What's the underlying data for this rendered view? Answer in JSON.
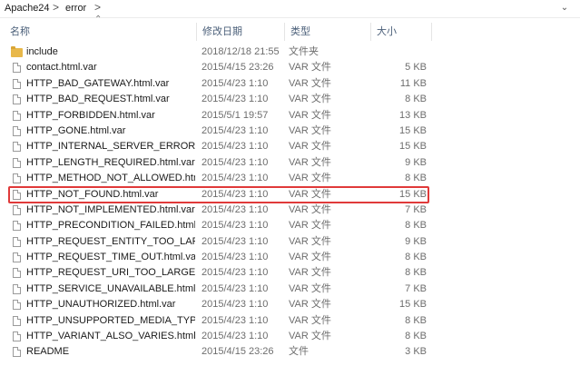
{
  "breadcrumb": {
    "items": [
      "Apache24",
      "error"
    ],
    "separator": ">"
  },
  "columns": {
    "name": "名称",
    "date": "修改日期",
    "type": "类型",
    "size": "大小"
  },
  "highlight_color": "#e03a3a",
  "files": [
    {
      "icon": "folder-icon",
      "name": "include",
      "date": "2018/12/18 21:55",
      "type": "文件夹",
      "size": ""
    },
    {
      "icon": "file-icon",
      "name": "contact.html.var",
      "date": "2015/4/15 23:26",
      "type": "VAR 文件",
      "size": "5 KB"
    },
    {
      "icon": "file-icon",
      "name": "HTTP_BAD_GATEWAY.html.var",
      "date": "2015/4/23 1:10",
      "type": "VAR 文件",
      "size": "11 KB"
    },
    {
      "icon": "file-icon",
      "name": "HTTP_BAD_REQUEST.html.var",
      "date": "2015/4/23 1:10",
      "type": "VAR 文件",
      "size": "8 KB"
    },
    {
      "icon": "file-icon",
      "name": "HTTP_FORBIDDEN.html.var",
      "date": "2015/5/1 19:57",
      "type": "VAR 文件",
      "size": "13 KB"
    },
    {
      "icon": "file-icon",
      "name": "HTTP_GONE.html.var",
      "date": "2015/4/23 1:10",
      "type": "VAR 文件",
      "size": "15 KB"
    },
    {
      "icon": "file-icon",
      "name": "HTTP_INTERNAL_SERVER_ERROR.ht...",
      "date": "2015/4/23 1:10",
      "type": "VAR 文件",
      "size": "15 KB"
    },
    {
      "icon": "file-icon",
      "name": "HTTP_LENGTH_REQUIRED.html.var",
      "date": "2015/4/23 1:10",
      "type": "VAR 文件",
      "size": "9 KB"
    },
    {
      "icon": "file-icon",
      "name": "HTTP_METHOD_NOT_ALLOWED.html...",
      "date": "2015/4/23 1:10",
      "type": "VAR 文件",
      "size": "8 KB"
    },
    {
      "icon": "file-icon",
      "name": "HTTP_NOT_FOUND.html.var",
      "date": "2015/4/23 1:10",
      "type": "VAR 文件",
      "size": "15 KB",
      "highlighted": true
    },
    {
      "icon": "file-icon",
      "name": "HTTP_NOT_IMPLEMENTED.html.var",
      "date": "2015/4/23 1:10",
      "type": "VAR 文件",
      "size": "7 KB"
    },
    {
      "icon": "file-icon",
      "name": "HTTP_PRECONDITION_FAILED.html.var",
      "date": "2015/4/23 1:10",
      "type": "VAR 文件",
      "size": "8 KB"
    },
    {
      "icon": "file-icon",
      "name": "HTTP_REQUEST_ENTITY_TOO_LARGE....",
      "date": "2015/4/23 1:10",
      "type": "VAR 文件",
      "size": "9 KB"
    },
    {
      "icon": "file-icon",
      "name": "HTTP_REQUEST_TIME_OUT.html.var",
      "date": "2015/4/23 1:10",
      "type": "VAR 文件",
      "size": "8 KB"
    },
    {
      "icon": "file-icon",
      "name": "HTTP_REQUEST_URI_TOO_LARGE.ht...",
      "date": "2015/4/23 1:10",
      "type": "VAR 文件",
      "size": "8 KB"
    },
    {
      "icon": "file-icon",
      "name": "HTTP_SERVICE_UNAVAILABLE.html.var",
      "date": "2015/4/23 1:10",
      "type": "VAR 文件",
      "size": "7 KB"
    },
    {
      "icon": "file-icon",
      "name": "HTTP_UNAUTHORIZED.html.var",
      "date": "2015/4/23 1:10",
      "type": "VAR 文件",
      "size": "15 KB"
    },
    {
      "icon": "file-icon",
      "name": "HTTP_UNSUPPORTED_MEDIA_TYPE.h...",
      "date": "2015/4/23 1:10",
      "type": "VAR 文件",
      "size": "8 KB"
    },
    {
      "icon": "file-icon",
      "name": "HTTP_VARIANT_ALSO_VARIES.html.var",
      "date": "2015/4/23 1:10",
      "type": "VAR 文件",
      "size": "8 KB"
    },
    {
      "icon": "file-icon",
      "name": "README",
      "date": "2015/4/15 23:26",
      "type": "文件",
      "size": "3 KB"
    }
  ]
}
